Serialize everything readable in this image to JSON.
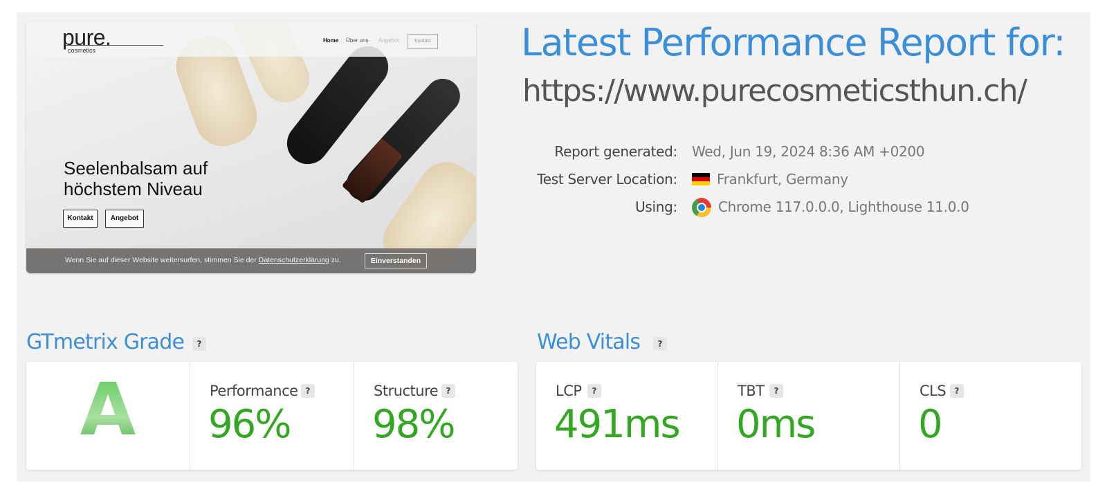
{
  "thumbnail": {
    "logo": "pure.",
    "logo_sub": "cosmetics",
    "menu": [
      "Home",
      "Über uns",
      "Angebot",
      "Kontakt"
    ],
    "headline": "Seelenbalsam auf höchstem Niveau",
    "buttons": [
      "Kontakt",
      "Angebot"
    ],
    "cookie_text_before": "Wenn Sie auf dieser Website weitersurfen, stimmen Sie der ",
    "cookie_link": "Datenschutzerklärung",
    "cookie_text_after": " zu.",
    "cookie_button": "Einverstanden"
  },
  "report": {
    "title": "Latest Performance Report for:",
    "url": "https://www.purecosmeticsthun.ch/",
    "generated_label": "Report generated:",
    "generated_value": "Wed, Jun 19, 2024 8:36 AM +0200",
    "location_label": "Test Server Location:",
    "location_value": "Frankfurt, Germany",
    "using_label": "Using:",
    "using_value": "Chrome 117.0.0.0, Lighthouse 11.0.0"
  },
  "grade_section": {
    "title": "GTmetrix Grade",
    "help": "?",
    "grade": "A",
    "performance_label": "Performance",
    "performance_value": "96%",
    "structure_label": "Structure",
    "structure_value": "98%"
  },
  "vitals_section": {
    "title": "Web Vitals",
    "help": "?",
    "lcp_label": "LCP",
    "lcp_value": "491ms",
    "tbt_label": "TBT",
    "tbt_value": "0ms",
    "cls_label": "CLS",
    "cls_value": "0"
  },
  "colors": {
    "accent_blue": "#3b8fd8",
    "good_green": "#31a81f"
  },
  "icons": [
    "germany-flag-icon",
    "chrome-icon",
    "help-icon"
  ]
}
